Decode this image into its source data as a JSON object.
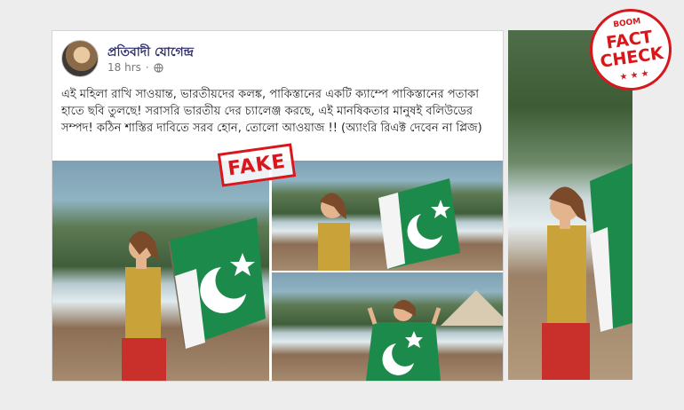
{
  "post": {
    "author": "প্রতিবাদী যোগেন্দ্র",
    "time": "18 hrs",
    "separator": "·",
    "privacy_icon": "globe-icon",
    "text": "এই মহিলা রাখি সাওয়ান্ত, ভারতীয়দের কলঙ্ক, পাকিস্তানের একটি ক্যাম্পে পাকিস্তানের পতাকা হাতে ছবি তুলছে! সরাসরি ভারতীয় দের চ্যালেঞ্জ করছে, এই মানষিকতার মানুষই বলিউডের সম্পদ! কঠিন শাস্তির দাবিতে সরব হোন, তোলো আওয়াজ !! (অ্যাংরি রিএক্ট দেবেন না প্লিজ)"
  },
  "stamp": {
    "fake_label": "FAKE"
  },
  "badge": {
    "boom": "BOOM",
    "line1": "FACT",
    "line2": "CHECK",
    "stars": "★ ★ ★"
  },
  "colors": {
    "stamp_red": "#d8161b",
    "flag_green": "#1c8a4a",
    "author_blue": "#2f2f6b"
  }
}
